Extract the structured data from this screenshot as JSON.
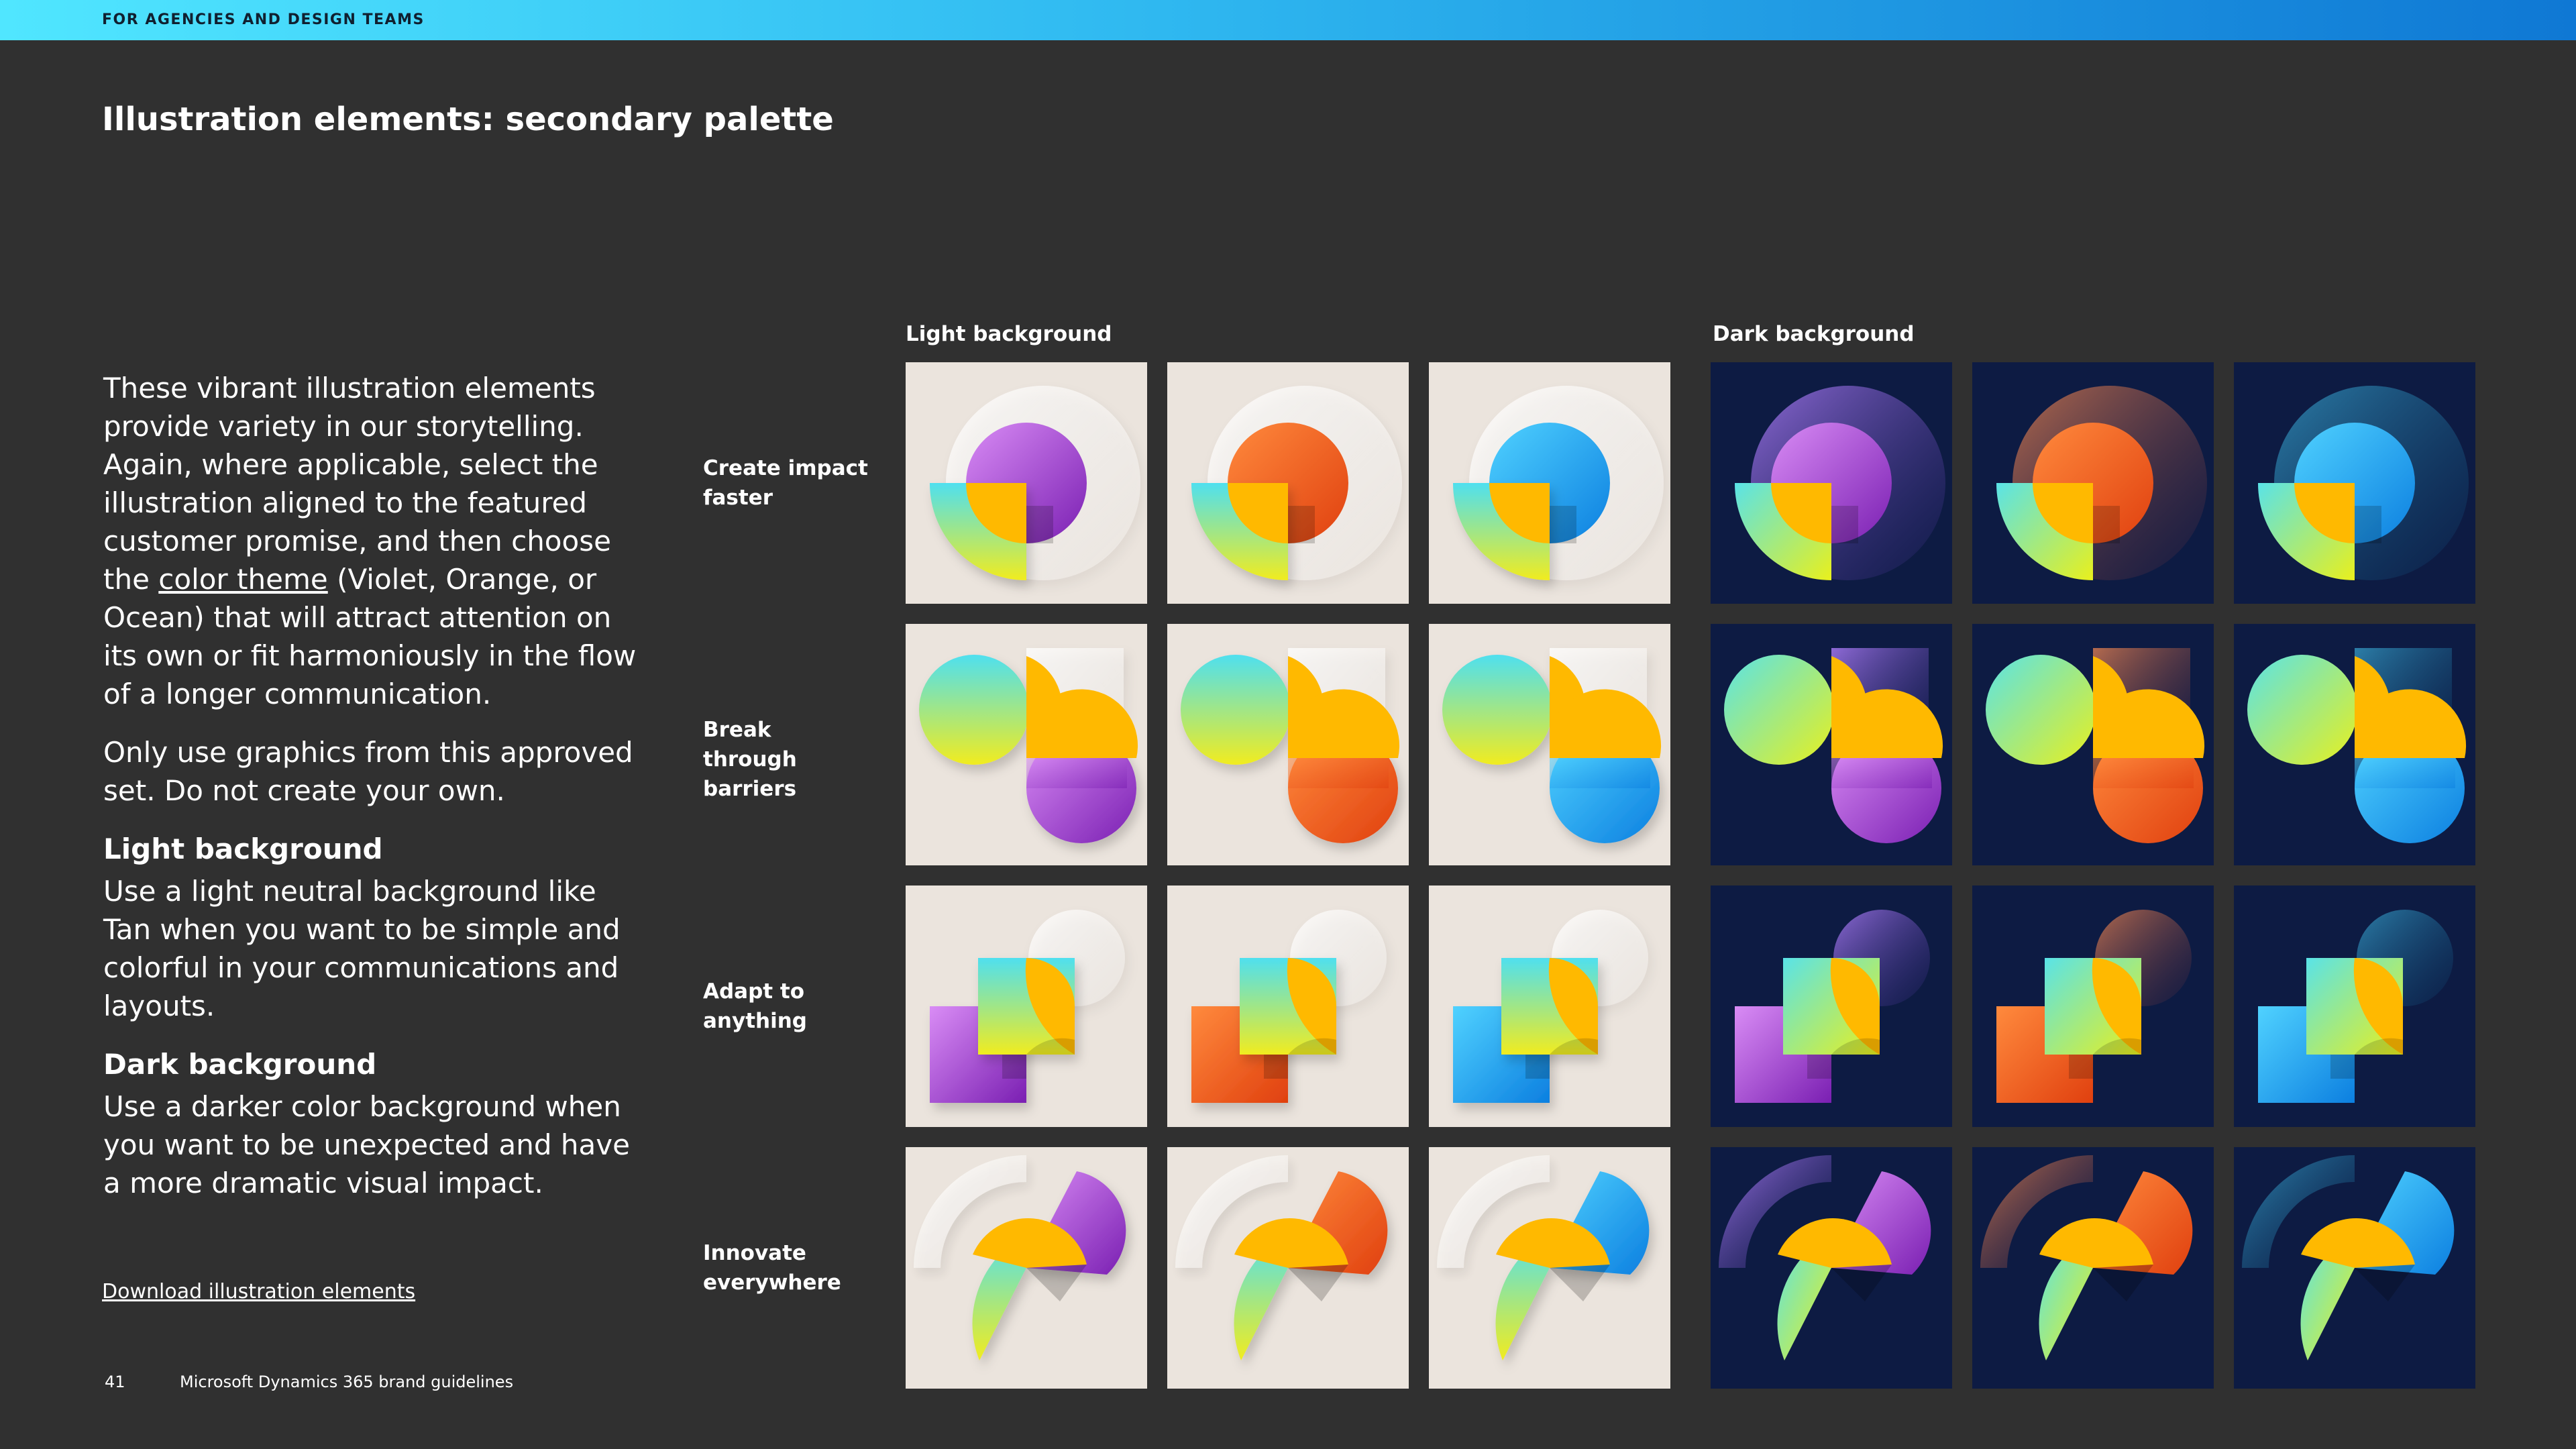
{
  "header": {
    "band_label": "FOR AGENCIES AND DESIGN TEAMS"
  },
  "page_title": "Illustration elements: secondary palette",
  "body": {
    "intro_before_link": "These vibrant illustration elements provide variety in our storytelling. Again, where applicable, select the illustration aligned to the featured customer promise, and then choose the ",
    "intro_link": "color theme",
    "intro_after_link": " (Violet, Orange, or Ocean) that will attract attention on its own or fit harmoniously in the flow of a longer communication.",
    "approved_note": "Only use graphics from this approved set. Do not create your own.",
    "light_heading": "Light background",
    "light_text": "Use a light neutral background like Tan when you want to be simple and colorful in your communications and layouts.",
    "dark_heading": "Dark background",
    "dark_text": "Use a darker color background when you want to be unexpected and have a more dramatic visual impact."
  },
  "download_link": "Download illustration elements",
  "footer": {
    "page_number": "41",
    "doc_title": "Microsoft Dynamics 365 brand guidelines"
  },
  "grid": {
    "light_heading": "Light background",
    "dark_heading": "Dark background",
    "rows": [
      "Create impact faster",
      "Break through barriers",
      "Adapt to anything",
      "Innovate everywhere"
    ],
    "themes": [
      "violet",
      "orange",
      "ocean"
    ]
  },
  "colors": {
    "topbar_start": "#50e6ff",
    "topbar_end": "#0f78d4",
    "page_background": "#303030",
    "tile_light": "#ebe4dd",
    "tile_dark": "#0d1b43",
    "violet": "#a64ad6",
    "orange": "#f2611d",
    "ocean": "#1ea7ee",
    "yellow": "#ffb900",
    "lime": "#e5ee2a",
    "cyan": "#4fe0ef"
  }
}
